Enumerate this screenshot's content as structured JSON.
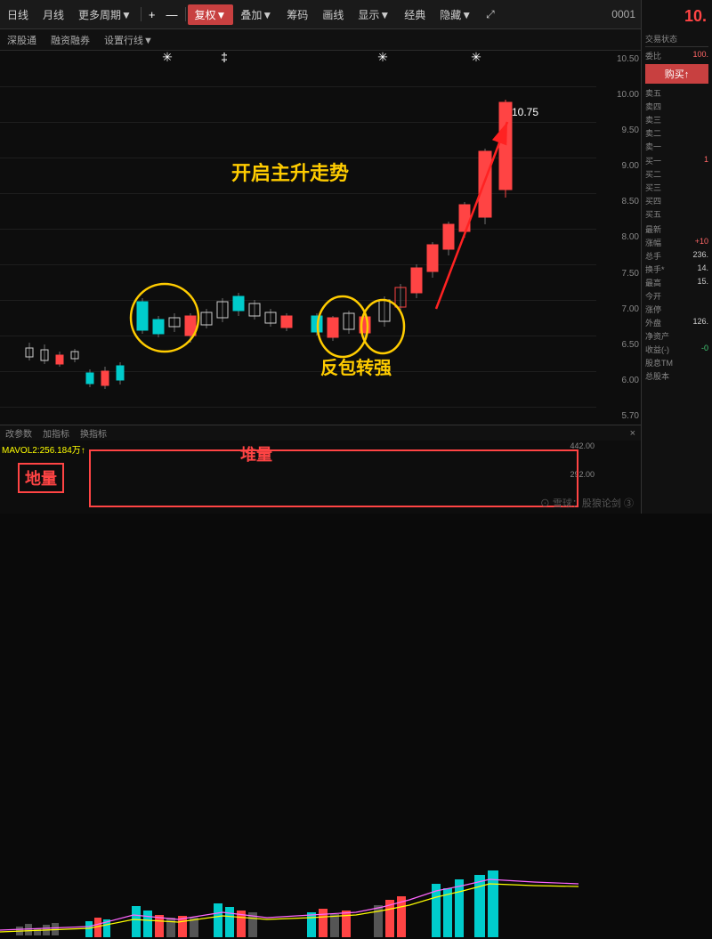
{
  "toolbar": {
    "period_buttons": [
      "日线",
      "月线",
      "更多周期▼"
    ],
    "action_buttons": [
      "+",
      "—",
      "复权▼",
      "叠加▼",
      "筹码",
      "画线",
      "显示▼",
      "经典",
      "隐藏▼",
      "⤢"
    ],
    "sub_buttons": [
      "深股通",
      "融资融券",
      "设置行线▼"
    ]
  },
  "chart": {
    "price_high": "10.75",
    "prices": [
      "10.50",
      "10.00",
      "9.50",
      "9.00",
      "8.50",
      "8.00",
      "7.50",
      "7.00",
      "6.50",
      "6.00",
      "5.70"
    ],
    "annotation_main": "开启主升走势",
    "annotation_reverse": "反包转强",
    "annotation_diliang": "地量",
    "annotation_duiliang": "堆量"
  },
  "right_panel": {
    "price_display": "10.",
    "trade_status": "交易状态",
    "wei_bi_label": "委比",
    "wei_bi_val": "100.",
    "buy_label": "购买↑",
    "sell_rows": [
      {
        "label": "卖五",
        "val": ""
      },
      {
        "label": "卖四",
        "val": ""
      },
      {
        "label": "卖三",
        "val": ""
      },
      {
        "label": "卖二",
        "val": ""
      },
      {
        "label": "卖一",
        "val": ""
      }
    ],
    "buy_rows": [
      {
        "label": "买一",
        "val": "1"
      },
      {
        "label": "买二",
        "val": ""
      },
      {
        "label": "买三",
        "val": ""
      },
      {
        "label": "买四",
        "val": ""
      },
      {
        "label": "买五",
        "val": ""
      }
    ],
    "stats": [
      {
        "label": "最新",
        "val": ""
      },
      {
        "label": "涨幅",
        "val": "+10",
        "color": "red"
      },
      {
        "label": "总手",
        "val": "236.",
        "color": "normal"
      },
      {
        "label": "换手*",
        "val": "14.",
        "color": "normal"
      },
      {
        "label": "最高",
        "val": "15.",
        "color": "normal"
      },
      {
        "label": "今开",
        "val": "",
        "color": "normal"
      },
      {
        "label": "涨停",
        "val": "",
        "color": "normal"
      },
      {
        "label": "外盘",
        "val": "126.",
        "color": "normal"
      },
      {
        "label": "净资产",
        "val": "",
        "color": "normal"
      },
      {
        "label": "收益(-)",
        "val": "-0",
        "color": "normal"
      },
      {
        "label": "股息TM",
        "val": "",
        "color": "normal"
      },
      {
        "label": "总股本",
        "val": "",
        "color": "normal"
      }
    ]
  },
  "volume": {
    "mavol_label": "MAVOL2:256.184万↑",
    "vol_scale": [
      "442.00",
      "292.00"
    ],
    "toolbar": [
      "改参数",
      "加指标",
      "换指标"
    ],
    "close_btn": "×"
  },
  "watermark": "⊙ 雪球：股狼论剑 ③"
}
